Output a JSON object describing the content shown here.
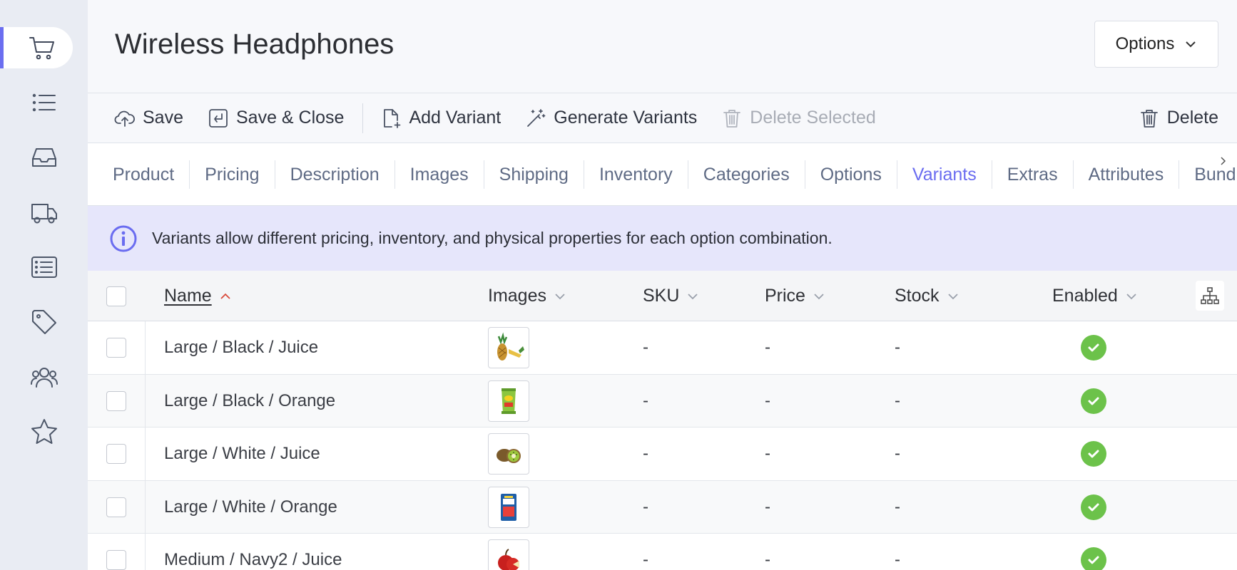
{
  "sidebar": {
    "items": [
      {
        "name": "cart-icon",
        "active": true
      },
      {
        "name": "list-icon"
      },
      {
        "name": "inbox-icon"
      },
      {
        "name": "truck-icon"
      },
      {
        "name": "list-box-icon"
      },
      {
        "name": "tag-icon"
      },
      {
        "name": "users-icon"
      },
      {
        "name": "star-icon"
      }
    ]
  },
  "header": {
    "title": "Wireless Headphones",
    "options_label": "Options"
  },
  "toolbar": {
    "save": "Save",
    "save_close": "Save & Close",
    "add_variant": "Add Variant",
    "generate_variants": "Generate Variants",
    "delete_selected": "Delete Selected",
    "delete": "Delete"
  },
  "tabs": [
    "Product",
    "Pricing",
    "Description",
    "Images",
    "Shipping",
    "Inventory",
    "Categories",
    "Options",
    "Variants",
    "Extras",
    "Attributes",
    "Bundles"
  ],
  "active_tab": "Variants",
  "info": {
    "text": "Variants allow different pricing, inventory, and physical properties for each option combination."
  },
  "table": {
    "columns": {
      "name": "Name",
      "images": "Images",
      "sku": "SKU",
      "price": "Price",
      "stock": "Stock",
      "enabled": "Enabled"
    },
    "rows": [
      {
        "name": "Large / Black / Juice",
        "image": "pineapple",
        "sku": "-",
        "price": "-",
        "stock": "-",
        "enabled": true
      },
      {
        "name": "Large / Black / Orange",
        "image": "chips-bag",
        "sku": "-",
        "price": "-",
        "stock": "-",
        "enabled": true
      },
      {
        "name": "Large / White / Juice",
        "image": "kiwi",
        "sku": "-",
        "price": "-",
        "stock": "-",
        "enabled": true
      },
      {
        "name": "Large / White / Orange",
        "image": "snack-box",
        "sku": "-",
        "price": "-",
        "stock": "-",
        "enabled": true
      },
      {
        "name": "Medium / Navy2 / Juice",
        "image": "apple",
        "sku": "-",
        "price": "-",
        "stock": "-",
        "enabled": true
      }
    ]
  },
  "colors": {
    "accent": "#6a6cf0",
    "enabled_green": "#6cc24a",
    "sort_arrow": "#d94a3a",
    "info_bg": "#e6e6fb"
  }
}
